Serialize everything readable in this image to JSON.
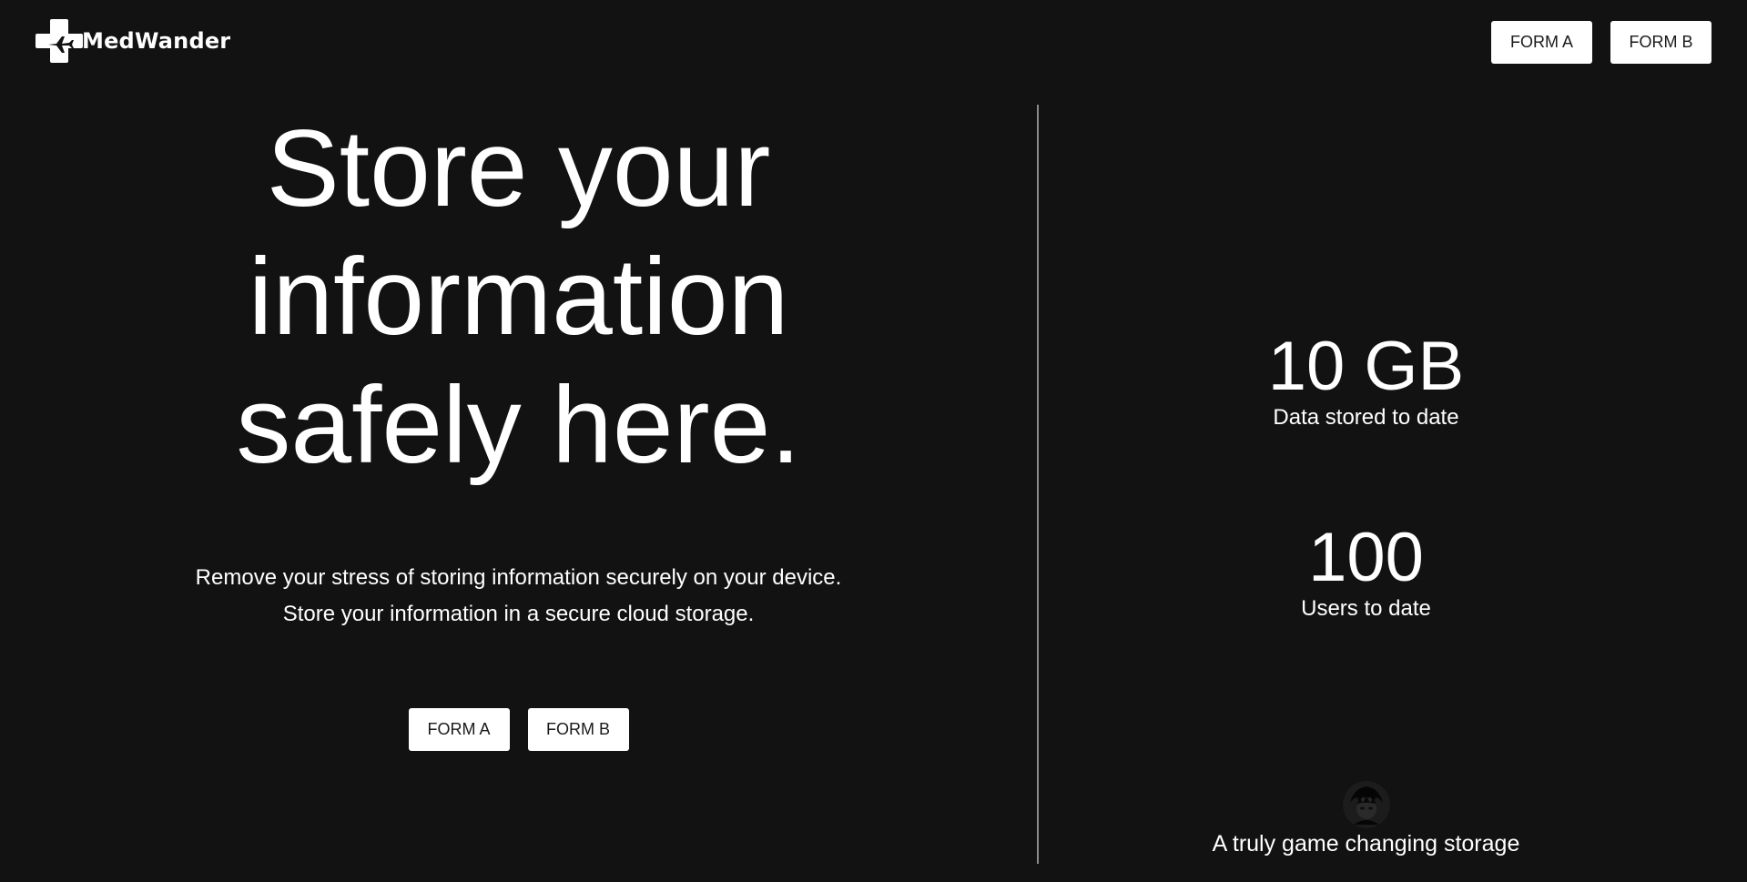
{
  "brand": {
    "name": "MedWander",
    "logo_icon": "medical-cross-airplane-icon"
  },
  "header": {
    "form_a_label": "FORM A",
    "form_b_label": "FORM B"
  },
  "hero": {
    "title_lines": [
      "Store your",
      "information",
      "safely here."
    ],
    "description_lines": [
      "Remove your stress of storing information securely on your device.",
      "Store your information in a secure cloud storage."
    ],
    "form_a_label": "FORM A",
    "form_b_label": "FORM B"
  },
  "stats": [
    {
      "value": "10 GB",
      "label": "Data stored to date"
    },
    {
      "value": "100",
      "label": "Users to date"
    }
  ],
  "testimonial": {
    "avatar_icon": "user-avatar",
    "text": "A truly game changing storage"
  },
  "colors": {
    "background": "#121212",
    "text": "#ffffff",
    "button_bg": "#ffffff",
    "button_text": "#1a1a1a",
    "divider": "#8a8a8a"
  }
}
